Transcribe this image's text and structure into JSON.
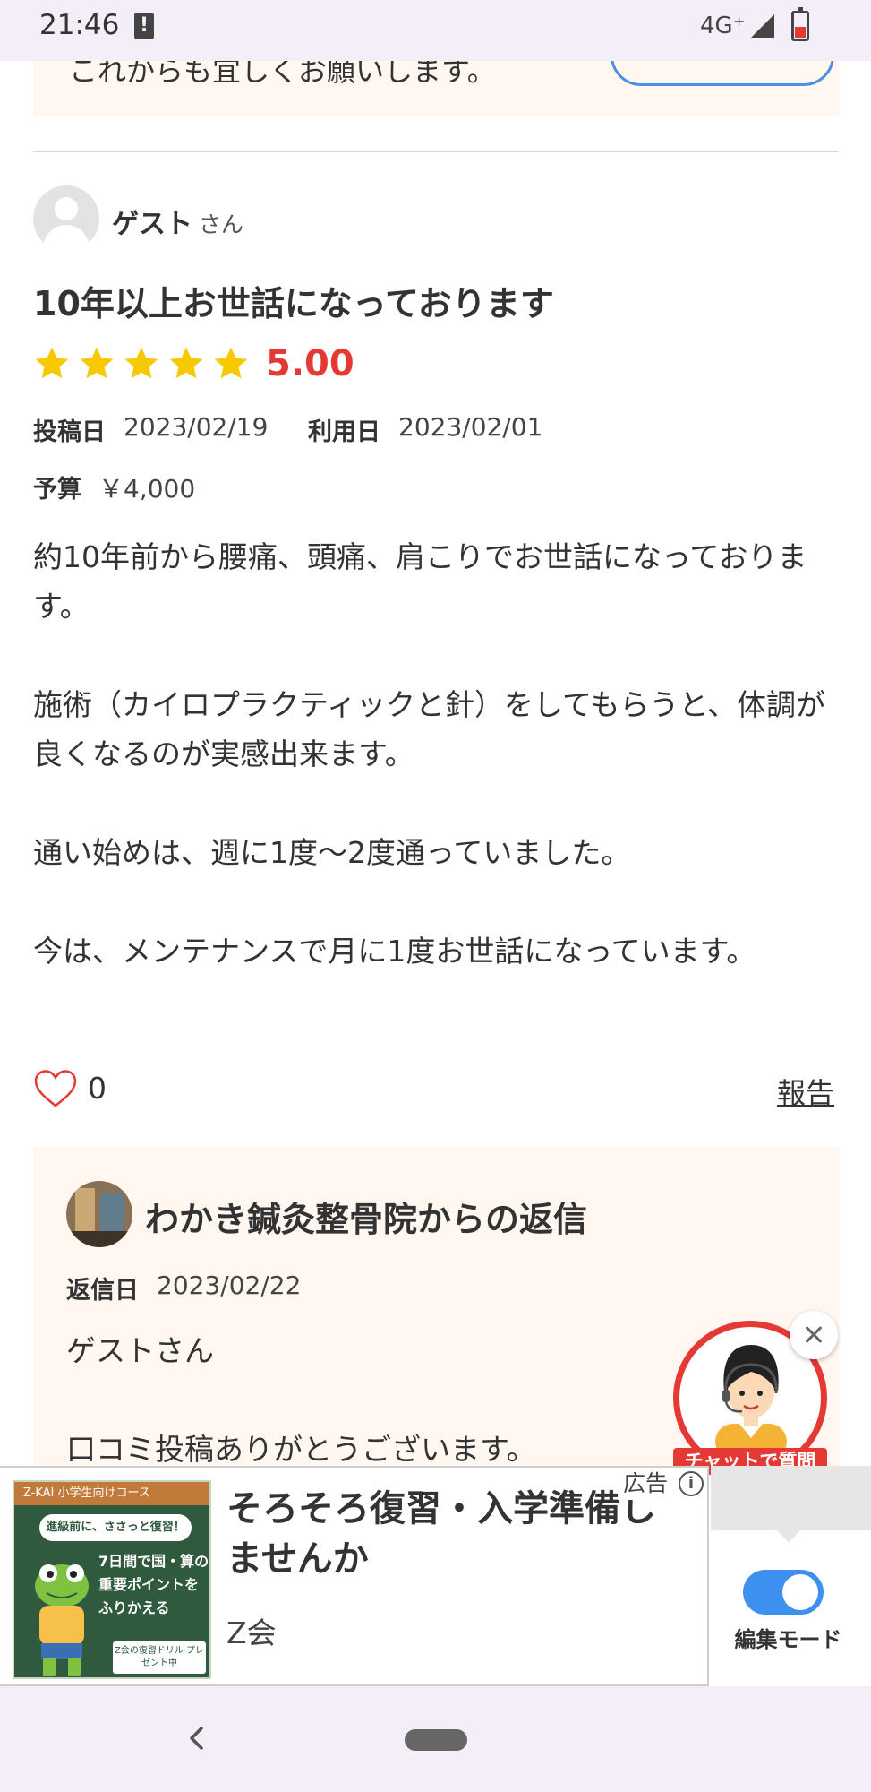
{
  "status_bar": {
    "time": "21:46",
    "network": "4G⁺",
    "icons": [
      "alert-icon",
      "signal-icon",
      "battery-icon"
    ]
  },
  "previous_card": {
    "text": "これからも宜しくお願いします。"
  },
  "review": {
    "reviewer_name": "ゲスト",
    "reviewer_suffix": "さん",
    "title": "10年以上お世話になっております",
    "rating": "5.00",
    "star_count": 5,
    "post_date_label": "投稿日",
    "post_date": "2023/02/19",
    "use_date_label": "利用日",
    "use_date": "2023/02/01",
    "budget_label": "予算",
    "budget": "￥4,000",
    "body": [
      "約10年前から腰痛、頭痛、肩こりでお世話になっております。",
      "施術（カイロプラクティックと針）をしてもらうと、体調が良くなるのが実感出来ます。",
      "通い始めは、週に1度〜2度通っていました。",
      "今は、メンテナンスで月に1度お世話になっています。"
    ],
    "like_count": "0",
    "report_label": "報告"
  },
  "reply": {
    "title": "わかき鍼灸整骨院からの返信",
    "date_label": "返信日",
    "date": "2023/02/22",
    "body": [
      "ゲストさん",
      "口コミ投稿ありがとうございます。"
    ]
  },
  "chat_widget": {
    "label": "チャットで質問"
  },
  "ad": {
    "image_header": "Z-KAI  小学生向けコース",
    "image_bubble": "進級前に、ささっと復習！",
    "image_text": "7日間で国・算の重要ポイントをふりかえる",
    "image_badge": "Z会の復習ドリル プレゼント中",
    "title": "そろそろ復習・入学準備しませんか",
    "advertiser": "Z会",
    "ad_label": "広告"
  },
  "edit_mode": {
    "label": "編集モード",
    "enabled": true
  },
  "colors": {
    "accent_red": "#e53935",
    "star_yellow": "#f7c900",
    "card_background": "#fff7f0",
    "toggle_blue": "#3d8ff0"
  }
}
